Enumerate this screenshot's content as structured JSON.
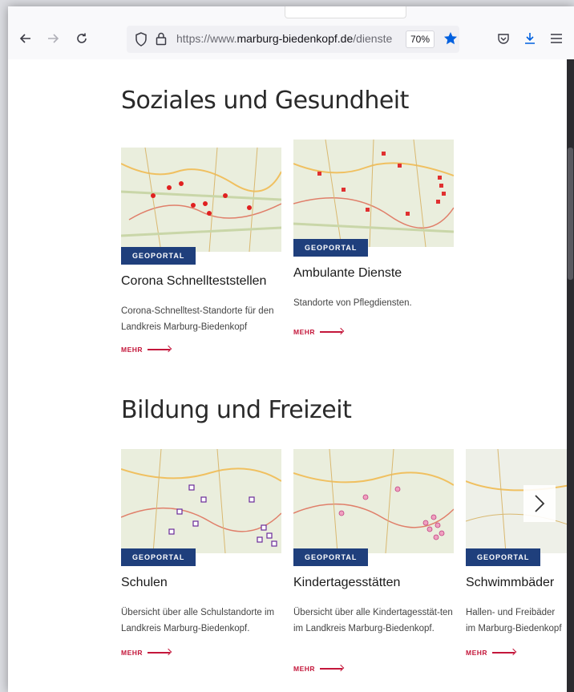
{
  "browser": {
    "url_prefix": "https://www.",
    "url_domain": "marburg-biedenkopf.de",
    "url_path": "/dienste",
    "zoom": "70%"
  },
  "sections": [
    {
      "title": "Soziales und Gesundheit",
      "cards": [
        {
          "badge": "GEOPORTAL",
          "title": "Corona Schnellteststellen",
          "desc": "Corona-Schnelltest-Standorte für den Landkreis Marburg-Biedenkopf",
          "more": "MEHR"
        },
        {
          "badge": "GEOPORTAL",
          "title": "Ambulante Dienste",
          "desc": "Standorte von Pflegdiensten.",
          "more": "MEHR"
        }
      ]
    },
    {
      "title": "Bildung und Freizeit",
      "cards": [
        {
          "badge": "GEOPORTAL",
          "title": "Schulen",
          "desc": "Übersicht über alle Schulstandorte im Landkreis Marburg-Biedenkopf.",
          "more": "MEHR"
        },
        {
          "badge": "GEOPORTAL",
          "title": "Kindertagesstätten",
          "desc": "Übersicht über alle Kindertagesstät-ten im Landkreis Marburg-Biedenkopf.",
          "more": "MEHR"
        },
        {
          "badge": "GEOPORTAL",
          "title": "Schwimmbäder",
          "desc": "Hallen- und Freibäder im Marburg-Biedenkopf",
          "more": "MEHR"
        }
      ]
    }
  ],
  "colors": {
    "badge": "#1f3f7c",
    "accent": "#c4173b",
    "star": "#0060df"
  }
}
